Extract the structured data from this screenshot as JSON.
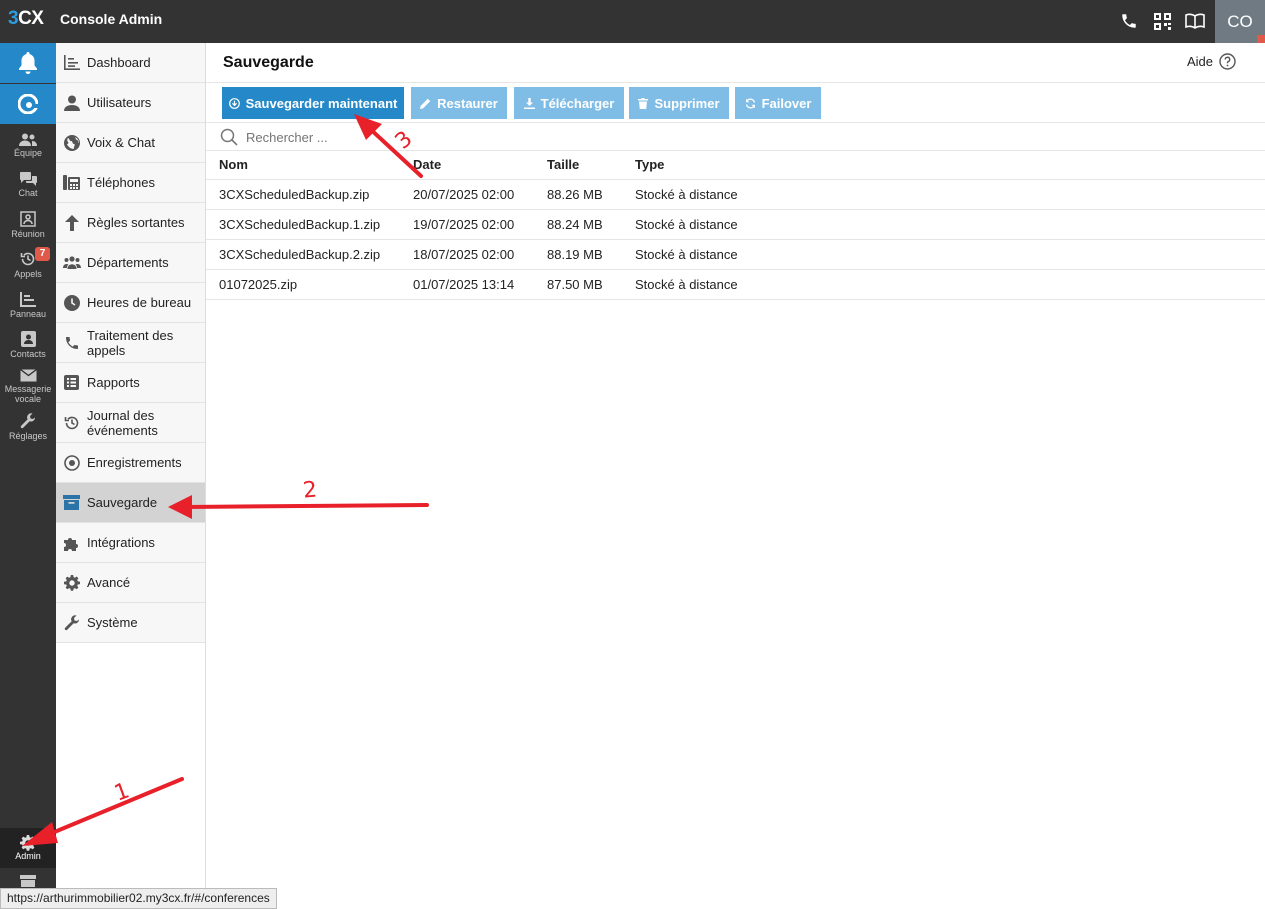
{
  "topbar": {
    "logo_3": "3",
    "logo_cx": "CX",
    "title": "Console Admin",
    "avatar": "CO",
    "icons": [
      "phone-icon",
      "qr-code-icon",
      "book-icon"
    ]
  },
  "rail": {
    "items": [
      {
        "label": "Équipe",
        "icon": "team-icon"
      },
      {
        "label": "Chat",
        "icon": "chat-icon"
      },
      {
        "label": "Réunion",
        "icon": "meeting-icon"
      },
      {
        "label": "Appels",
        "icon": "history-icon",
        "badge": "7"
      },
      {
        "label": "Panneau",
        "icon": "panel-icon"
      },
      {
        "label": "Contacts",
        "icon": "contacts-icon"
      },
      {
        "label": "Messagerie vocale",
        "icon": "mail-icon"
      },
      {
        "label": "Réglages",
        "icon": "wrench-icon"
      }
    ],
    "admin_label": "Admin"
  },
  "nav": {
    "items": [
      {
        "label": "Dashboard",
        "icon": "dashboard-icon"
      },
      {
        "label": "Utilisateurs",
        "icon": "user-icon"
      },
      {
        "label": "Voix & Chat",
        "icon": "globe-icon"
      },
      {
        "label": "Téléphones",
        "icon": "phone-desk-icon"
      },
      {
        "label": "Règles sortantes",
        "icon": "arrow-up-icon"
      },
      {
        "label": "Départements",
        "icon": "departments-icon"
      },
      {
        "label": "Heures de bureau",
        "icon": "clock-icon"
      },
      {
        "label": "Traitement des appels",
        "icon": "phone-handset-icon"
      },
      {
        "label": "Rapports",
        "icon": "report-icon"
      },
      {
        "label": "Journal des événements",
        "icon": "history-icon"
      },
      {
        "label": "Enregistrements",
        "icon": "record-icon"
      },
      {
        "label": "Sauvegarde",
        "icon": "archive-icon",
        "active": true
      },
      {
        "label": "Intégrations",
        "icon": "puzzle-icon"
      },
      {
        "label": "Avancé",
        "icon": "gear-icon"
      },
      {
        "label": "Système",
        "icon": "wrench-icon"
      }
    ]
  },
  "main": {
    "title": "Sauvegarde",
    "help": "Aide",
    "toolbar": {
      "backup_now": "Sauvegarder maintenant",
      "restore": "Restaurer",
      "download": "Télécharger",
      "delete": "Supprimer",
      "failover": "Failover"
    },
    "search_placeholder": "Rechercher ...",
    "table": {
      "headers": [
        "Nom",
        "Date",
        "Taille",
        "Type"
      ],
      "rows": [
        [
          "3CXScheduledBackup.zip",
          "20/07/2025 02:00",
          "88.26 MB",
          "Stocké à distance"
        ],
        [
          "3CXScheduledBackup.1.zip",
          "19/07/2025 02:00",
          "88.24 MB",
          "Stocké à distance"
        ],
        [
          "3CXScheduledBackup.2.zip",
          "18/07/2025 02:00",
          "88.19 MB",
          "Stocké à distance"
        ],
        [
          "01072025.zip",
          "01/07/2025 13:14",
          "87.50 MB",
          "Stocké à distance"
        ]
      ]
    }
  },
  "status_url": "https://arthurimmobilier02.my3cx.fr/#/conferences",
  "annotations": [
    "1",
    "2",
    "3"
  ],
  "colors": {
    "accent": "#2589c9",
    "accent_disabled": "#7fbde6",
    "annotation": "#e8202a",
    "dark": "#333333"
  }
}
